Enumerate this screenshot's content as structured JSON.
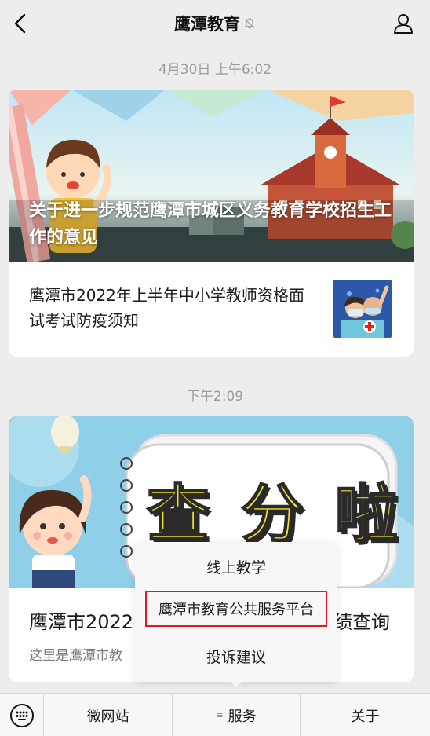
{
  "header": {
    "title": "鹰潭教育"
  },
  "messages": [
    {
      "timestamp": "4月30日 上午6:02",
      "cover_title": "关于进一步规范鹰潭市城区义务教育学校招生工作的意见",
      "sub_article": "鹰潭市2022年上半年中小学教师资格面试考试防疫须知"
    },
    {
      "timestamp": "下午2:09",
      "cover_title": "查 分 啦",
      "title_start": "鹰潭市2022",
      "title_end": "绩查询",
      "desc_start": "这里是鹰潭市教"
    }
  ],
  "popup": {
    "items": [
      "线上教学",
      "鹰潭市教育公共服务平台",
      "投诉建议"
    ]
  },
  "bottom_menu": {
    "tabs": [
      "微网站",
      "服务",
      "关于"
    ],
    "service_glyph": "≡"
  },
  "colors": {
    "highlight_border": "#e0191e"
  }
}
